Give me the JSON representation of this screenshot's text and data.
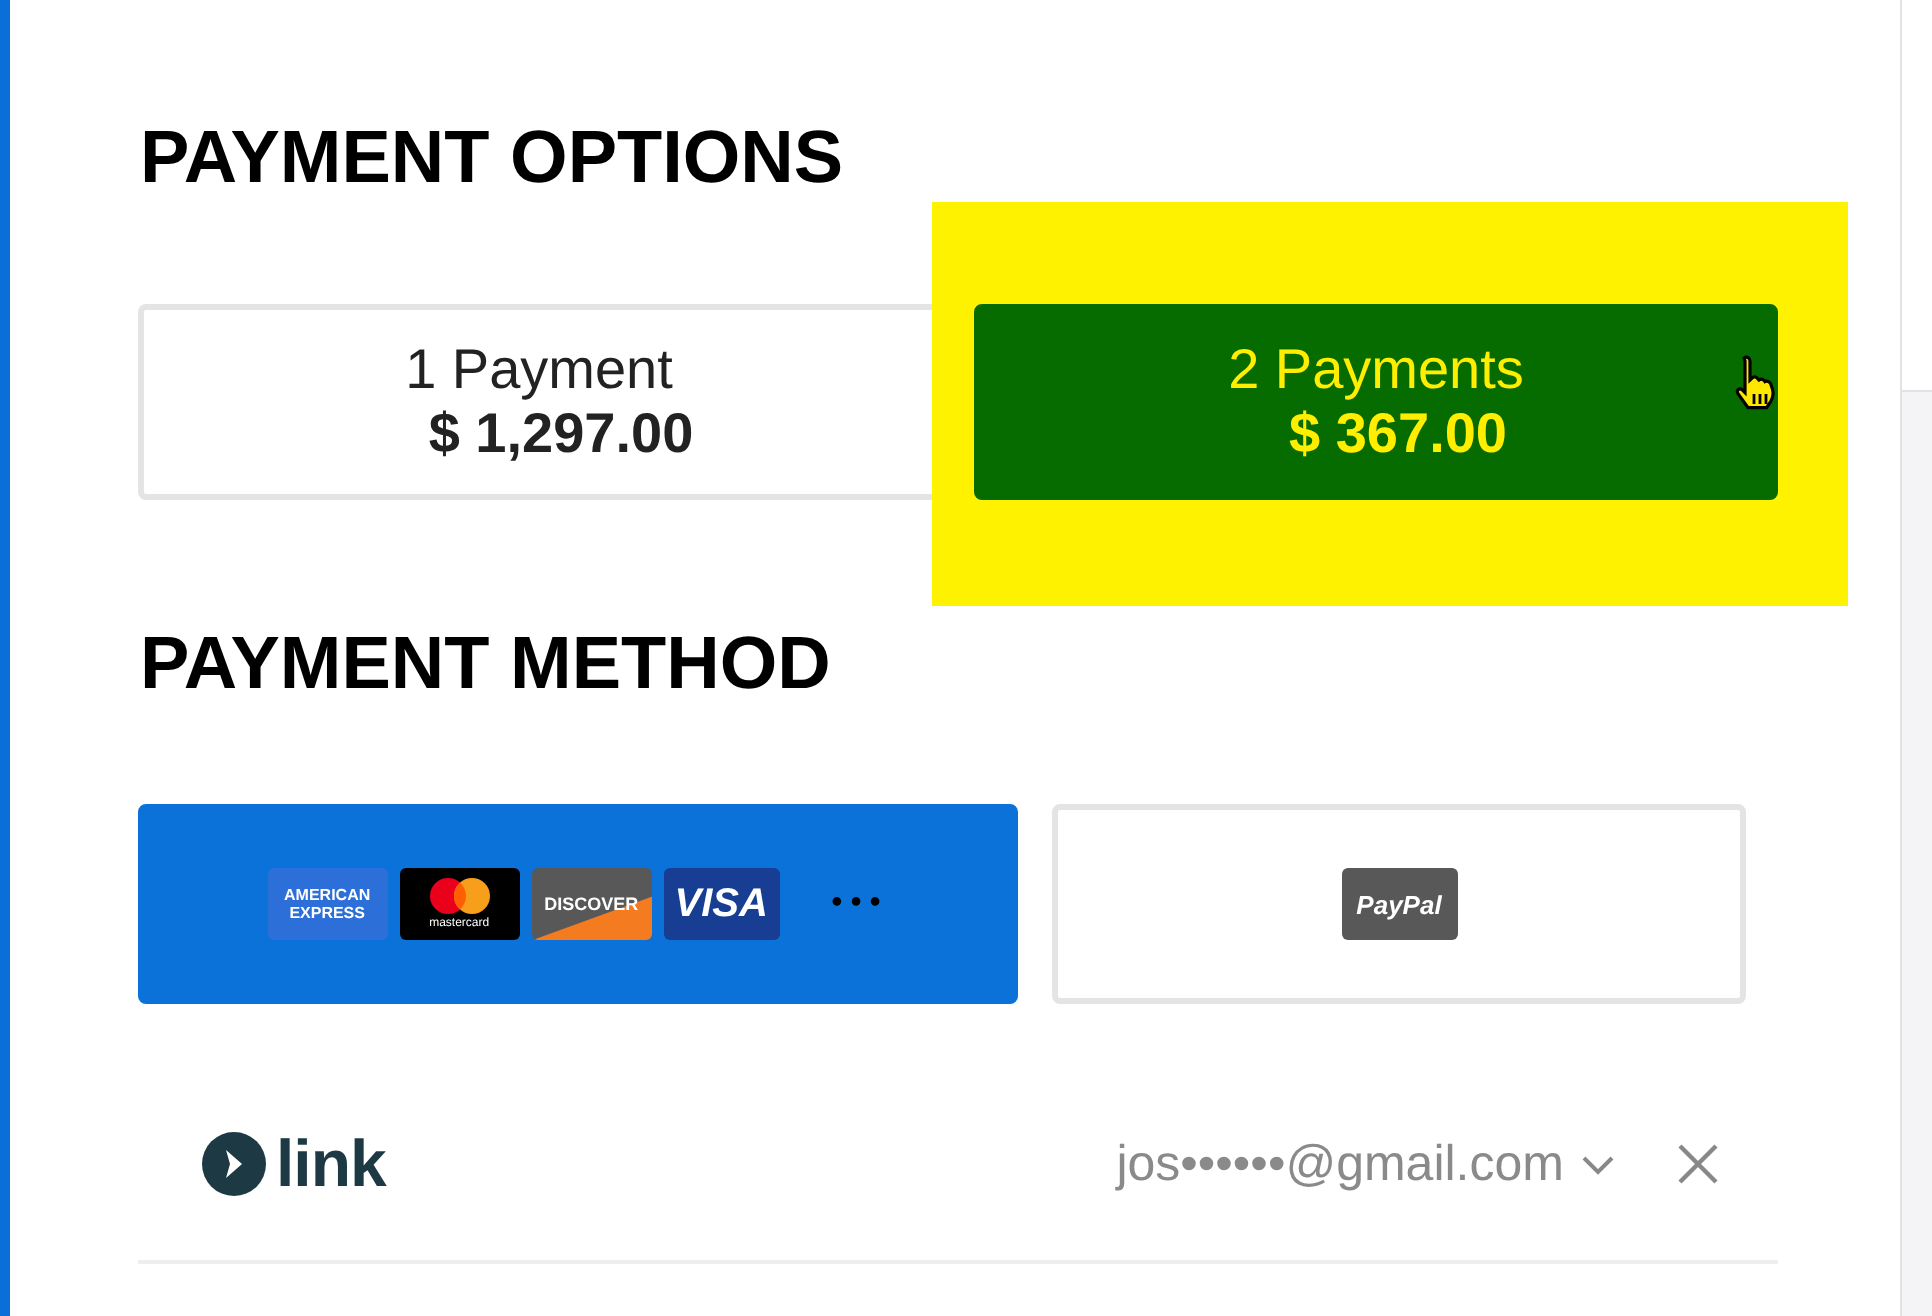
{
  "payment_options": {
    "title": "PAYMENT OPTIONS",
    "options": [
      {
        "label": "1 Payment",
        "amount": "$ 1,297.00",
        "selected": false,
        "highlighted": false,
        "hovered": false
      },
      {
        "label": "2 Payments",
        "amount": "$ 367.00",
        "selected": true,
        "highlighted": true,
        "hovered": true
      }
    ]
  },
  "payment_method": {
    "title": "PAYMENT METHOD",
    "methods": [
      {
        "kind": "cards",
        "selected": true,
        "brands": [
          {
            "kind": "amex",
            "label": "AMERICAN EXPRESS"
          },
          {
            "kind": "mastercard",
            "label": "mastercard"
          },
          {
            "kind": "discover",
            "label": "DISCOVER"
          },
          {
            "kind": "visa",
            "label": "VISA"
          }
        ],
        "more": "•••"
      },
      {
        "kind": "paypal",
        "selected": false,
        "label": "PayPal"
      }
    ]
  },
  "link": {
    "brand": "link",
    "email": "jos••••••@gmail.com"
  }
}
